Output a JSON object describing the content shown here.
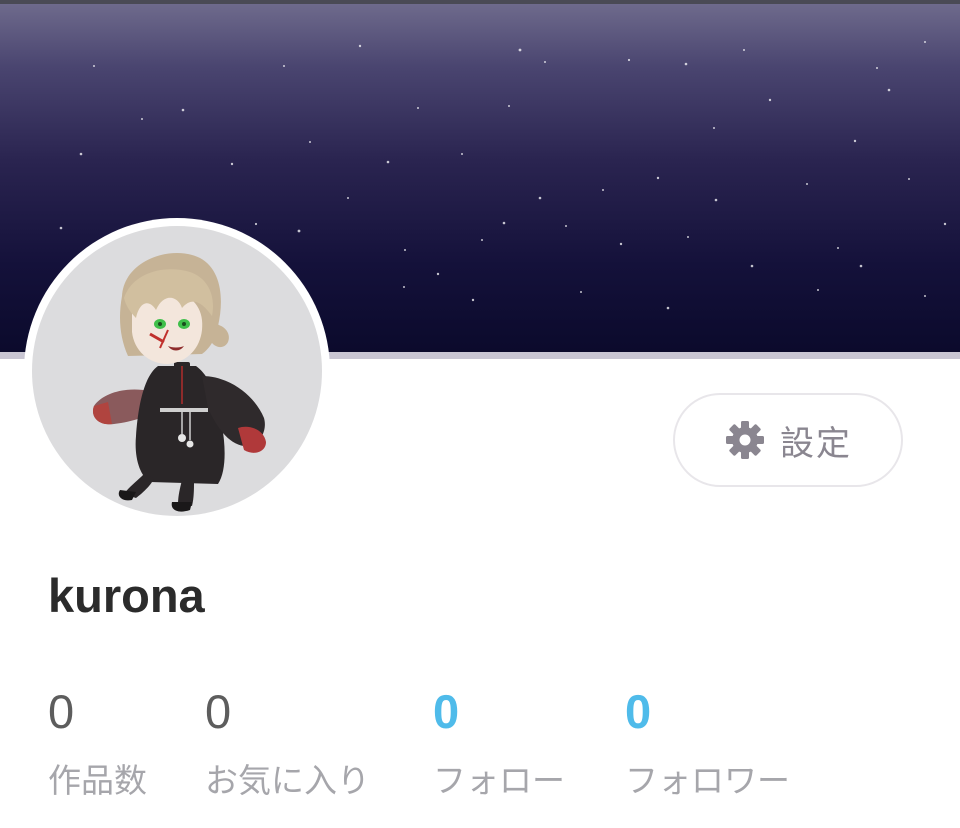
{
  "profile": {
    "username": "kurona",
    "avatar": "character-avatar",
    "header": "starry-night-banner"
  },
  "settings_button": {
    "label": "設定",
    "icon": "gear-icon"
  },
  "stats": [
    {
      "value": "0",
      "label": "作品数"
    },
    {
      "value": "0",
      "label": "お気に入り"
    },
    {
      "value": "0",
      "label": "フォロー"
    },
    {
      "value": "0",
      "label": "フォロワー"
    }
  ],
  "colors": {
    "link_blue": "#4fbbea",
    "header_top": "#6e6a8c",
    "header_bottom": "#0b0a2c",
    "muted_text": "#a6a6ab"
  }
}
